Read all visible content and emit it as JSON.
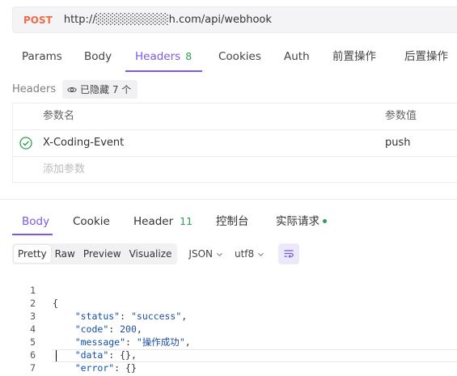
{
  "request": {
    "method": "POST",
    "url": "http://░░░░░░░░░h.com/api/webhook"
  },
  "request_tabs": [
    {
      "label": "Params"
    },
    {
      "label": "Body"
    },
    {
      "label": "Headers",
      "badge": "8"
    },
    {
      "label": "Cookies"
    },
    {
      "label": "Auth"
    },
    {
      "label": "前置操作"
    },
    {
      "label": "后置操作"
    }
  ],
  "headers_section": {
    "title": "Headers",
    "hidden_label": "已隐藏 7 个",
    "col_name": "参数名",
    "col_value": "参数值",
    "rows": [
      {
        "name": "X-Coding-Event",
        "value": "push"
      }
    ],
    "add_placeholder": "添加参数"
  },
  "response_tabs": [
    {
      "label": "Body"
    },
    {
      "label": "Cookie"
    },
    {
      "label": "Header",
      "badge": "11"
    },
    {
      "label": "控制台"
    },
    {
      "label": "实际请求"
    }
  ],
  "view_modes": [
    "Pretty",
    "Raw",
    "Preview",
    "Visualize"
  ],
  "format_select": "JSON",
  "encoding_select": "utf8",
  "code_lines": [
    {
      "n": "1"
    },
    {
      "n": "2"
    },
    {
      "n": "3"
    },
    {
      "n": "4"
    },
    {
      "n": "5"
    },
    {
      "n": "6"
    },
    {
      "n": "7"
    }
  ],
  "response_json": {
    "status": "success",
    "code": "200",
    "message": "操作成功",
    "data": "{}",
    "error": "{}"
  },
  "colors": {
    "accent": "#7b5ae0",
    "method": "#ef6a47",
    "badge_green": "#2f9e57"
  }
}
